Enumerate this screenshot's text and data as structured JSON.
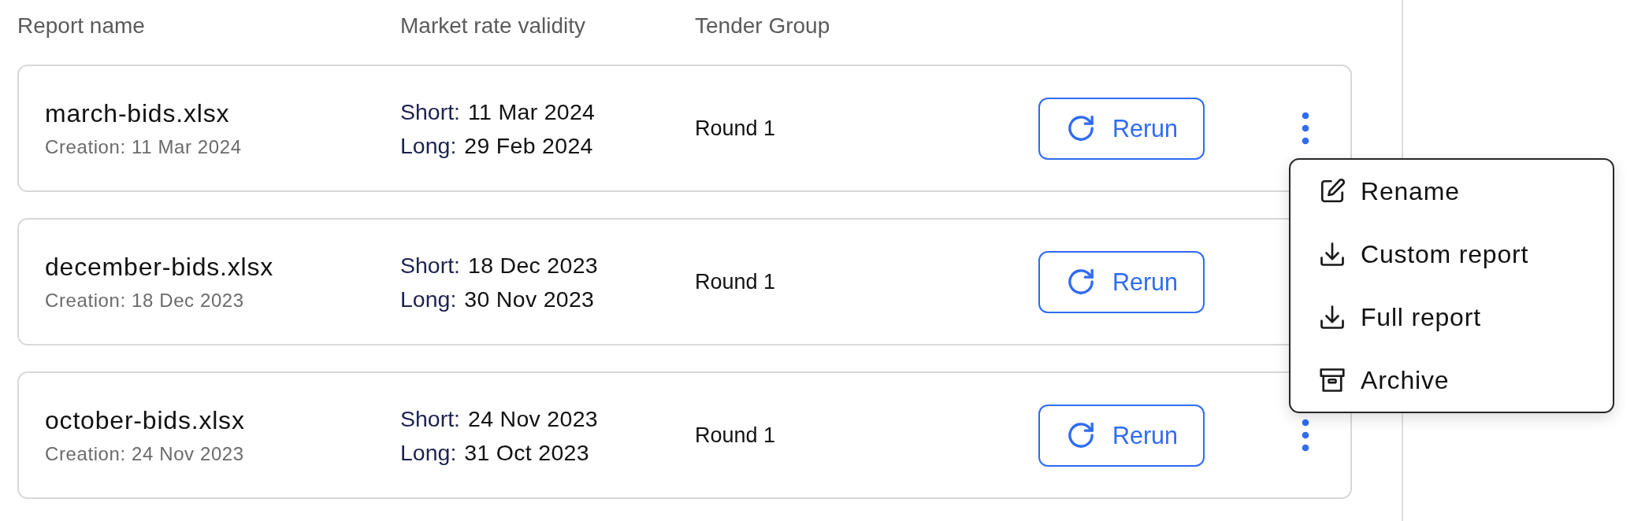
{
  "columns": [
    "Report name",
    "Market rate validity",
    "Tender Group"
  ],
  "reports": [
    {
      "name": "march-bids.xlsx",
      "creation": "Creation: 11 Mar 2024",
      "validity": [
        {
          "label": "Short:",
          "date": "11 Mar 2024"
        },
        {
          "label": "Long:",
          "date": "29 Feb 2024"
        }
      ],
      "tender_group": "Round 1",
      "action": "Rerun",
      "menu": {
        "items": [
          {
            "kind": "edit",
            "label": "Rename"
          },
          {
            "kind": "download",
            "label": "Custom report"
          },
          {
            "kind": "download",
            "label": "Full report"
          },
          {
            "kind": "archive",
            "label": "Archive"
          }
        ]
      }
    },
    {
      "name": "december-bids.xlsx",
      "creation": "Creation: 18 Dec 2023",
      "validity": [
        {
          "label": "Short:",
          "date": "18 Dec 2023"
        },
        {
          "label": "Long:",
          "date": "30 Nov 2023"
        }
      ],
      "tender_group": "Round 1",
      "action": "Rerun"
    },
    {
      "name": "october-bids.xlsx",
      "creation": "Creation: 24 Nov 2023",
      "validity": [
        {
          "label": "Short:",
          "date": "24 Nov 2023"
        },
        {
          "label": "Long:",
          "date": "31 Oct 2023"
        }
      ],
      "tender_group": "Round 1",
      "action": "Rerun"
    }
  ]
}
